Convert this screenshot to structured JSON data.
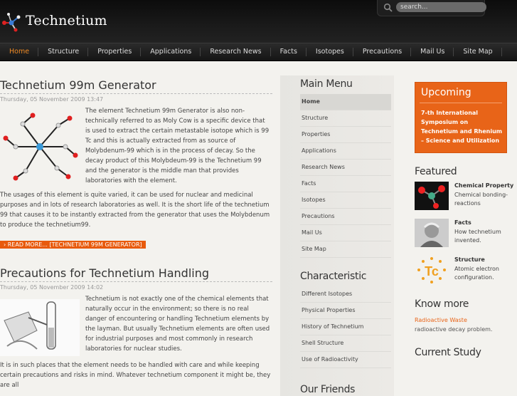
{
  "brand": {
    "name": "Technetium"
  },
  "search": {
    "placeholder": "search..."
  },
  "nav": [
    "Home",
    "Structure",
    "Properties",
    "Applications",
    "Research News",
    "Facts",
    "Isotopes",
    "Precautions",
    "Mail Us",
    "Site Map"
  ],
  "articles": [
    {
      "title": "Technetium 99m Generator",
      "date": "Thursday, 05 November 2009 13:47",
      "intro": "The element Technetium 99m Generator is also non-technically referred to as Moly Cow is a specific device that is used to extract the certain metastable isotope which is 99 Tc and this is actually extracted from as source of Molybdenum-99 which is in the process of decay. So the decay product of this Molybdeum-99 is the Technetium 99 and the generator is the middle man that provides laboratories with the element.",
      "body": "The usages of this element is quite varied, it can be used for nuclear and medicinal purposes and in lots of research laboratories as well. It is the short life of the technetium 99 that causes it to be instantly extracted from the generator that uses the Molybdenum to produce the technetium99.",
      "readmore": "› READ MORE... [TECHNETIUM 99M GENERATOR]"
    },
    {
      "title": "Precautions for Technetium Handling",
      "date": "Thursday, 05 November 2009 14:02",
      "intro": "Technetium is not exactly one of the chemical elements that naturally occur in the environment; so there is no real danger of encountering or handling Technetium elements by the layman. But usually Technetium elements are often used for industrial purposes and most commonly in research laboratories for nuclear studies.",
      "body": "It is in such places that the element needs to be handled with care and while keeping certain precautions and risks in mind. Whatever technetium component it might be, they are all"
    }
  ],
  "main_menu": {
    "title": "Main Menu",
    "items": [
      "Home",
      "Structure",
      "Properties",
      "Applications",
      "Research News",
      "Facts",
      "Isotopes",
      "Precautions",
      "Mail Us",
      "Site Map"
    ]
  },
  "characteristic": {
    "title": "Characteristic",
    "items": [
      "Different Isotopes",
      "Physical Properties",
      "History of Technetium",
      "Shell Structure",
      "Use of Radioactivity"
    ]
  },
  "friends": {
    "title": "Our Friends"
  },
  "upcoming": {
    "title": "Upcoming",
    "text": "7-th International Symposium on Technetium and Rhenium – Science and Utilization"
  },
  "featured": {
    "title": "Featured",
    "items": [
      {
        "head": "Chemical Property",
        "sub": "Chemical bonding-reactions"
      },
      {
        "head": "Facts",
        "sub": "How technetium invented."
      },
      {
        "head": "Structure",
        "sub": "Atomic electron configuration."
      }
    ]
  },
  "knowmore": {
    "title": "Know more",
    "link": "Radioactive Waste",
    "sub": "radioactive decay problem."
  },
  "study": {
    "title": "Current Study"
  },
  "colors": {
    "accent": "#e86418",
    "nav_active": "#f08a24"
  }
}
